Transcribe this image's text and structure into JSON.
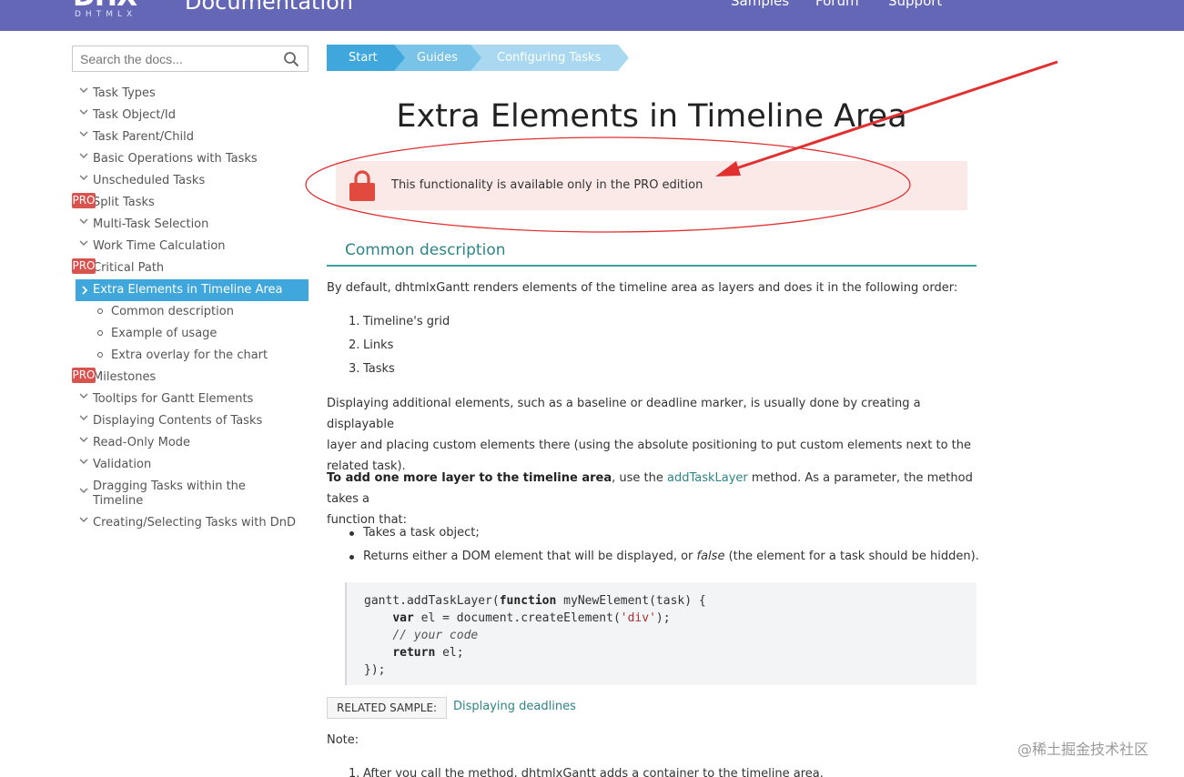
{
  "header": {
    "logo_mark": "DHX",
    "logo_sub": "DHTMLX",
    "site_title": "Documentation",
    "nav": [
      "Samples",
      "Forum",
      "Support"
    ]
  },
  "search": {
    "placeholder": "Search the docs..."
  },
  "sidebar": {
    "items": [
      {
        "label": "Task Types",
        "kind": "normal"
      },
      {
        "label": "Task Object/Id",
        "kind": "normal"
      },
      {
        "label": "Task Parent/Child",
        "kind": "normal"
      },
      {
        "label": "Basic Operations with Tasks",
        "kind": "normal"
      },
      {
        "label": "Unscheduled Tasks",
        "kind": "normal"
      },
      {
        "label": "Split Tasks",
        "kind": "pro",
        "badge": "PRO"
      },
      {
        "label": "Multi-Task Selection",
        "kind": "normal"
      },
      {
        "label": "Work Time Calculation",
        "kind": "normal"
      },
      {
        "label": "Critical Path",
        "kind": "pro",
        "badge": "PRO"
      },
      {
        "label": "Extra Elements in Timeline Area",
        "kind": "active"
      },
      {
        "label": "Common description",
        "kind": "sub"
      },
      {
        "label": "Example of usage",
        "kind": "sub"
      },
      {
        "label": "Extra overlay for the chart",
        "kind": "sub"
      },
      {
        "label": "Milestones",
        "kind": "pro",
        "badge": "PRO"
      },
      {
        "label": "Tooltips for Gantt Elements",
        "kind": "normal"
      },
      {
        "label": "Displaying Contents of Tasks",
        "kind": "normal"
      },
      {
        "label": "Read-Only Mode",
        "kind": "normal"
      },
      {
        "label": "Validation",
        "kind": "normal"
      },
      {
        "label": "Dragging Tasks within the",
        "label2": "Timeline",
        "kind": "normal"
      },
      {
        "label": "Creating/Selecting Tasks with DnD",
        "kind": "normal"
      }
    ]
  },
  "breadcrumb": [
    "Start",
    "Guides",
    "Configuring Tasks"
  ],
  "main": {
    "title": "Extra Elements in Timeline Area",
    "pro_notice": "This functionality is available only in the PRO edition",
    "section_title": "Common description",
    "intro": "By default, dhtmlxGantt renders elements of the timeline area as layers and does it in the following order:",
    "order_list": [
      "Timeline's grid",
      "Links",
      "Tasks"
    ],
    "para2_line1": "Displaying additional elements, such as a baseline or deadline marker, is usually done by creating a displayable",
    "para2_line2": "layer and placing custom elements there (using the absolute positioning to put custom elements next to the",
    "para2_line3": "related task).",
    "para3_bold": "To add one more layer to the timeline area",
    "para3_pre_link": ", use the ",
    "para3_link": "addTaskLayer",
    "para3_post_link": " method. As a parameter, the method takes a",
    "para3_line2": "function that:",
    "bullet1": "Takes a task object;",
    "bullet2_pre": "Returns either a DOM element that will be displayed, or ",
    "bullet2_em": "false",
    "bullet2_post": " (the element for a task should be hidden).",
    "related_label": "RELATED SAMPLE:",
    "related_link": "Displaying deadlines",
    "note": "Note:",
    "note_item": "After you call the method, dhtmlxGantt adds a container to the timeline area."
  },
  "code": {
    "l1_a": "gantt.addTaskLayer(",
    "l1_kw": "function",
    "l1_b": " myNewElement(task) {",
    "l2_kw": "var",
    "l2_a": " el = document.createElement(",
    "l2_str": "'div'",
    "l2_b": ");",
    "l3_cm": "// your code",
    "l4_kw": "return",
    "l4_a": " el;",
    "l5": "});"
  },
  "watermark": "@稀土掘金技术社区",
  "colors": {
    "header_bg": "#6466b6",
    "crumb1": "#3fa7dc",
    "crumb2": "#79c3e8",
    "crumb3": "#a9d8f0",
    "active_item": "#3fa7dc",
    "pro_badge": "#d9534f",
    "teal": "#2d8588",
    "annotation_red": "#e03030"
  }
}
